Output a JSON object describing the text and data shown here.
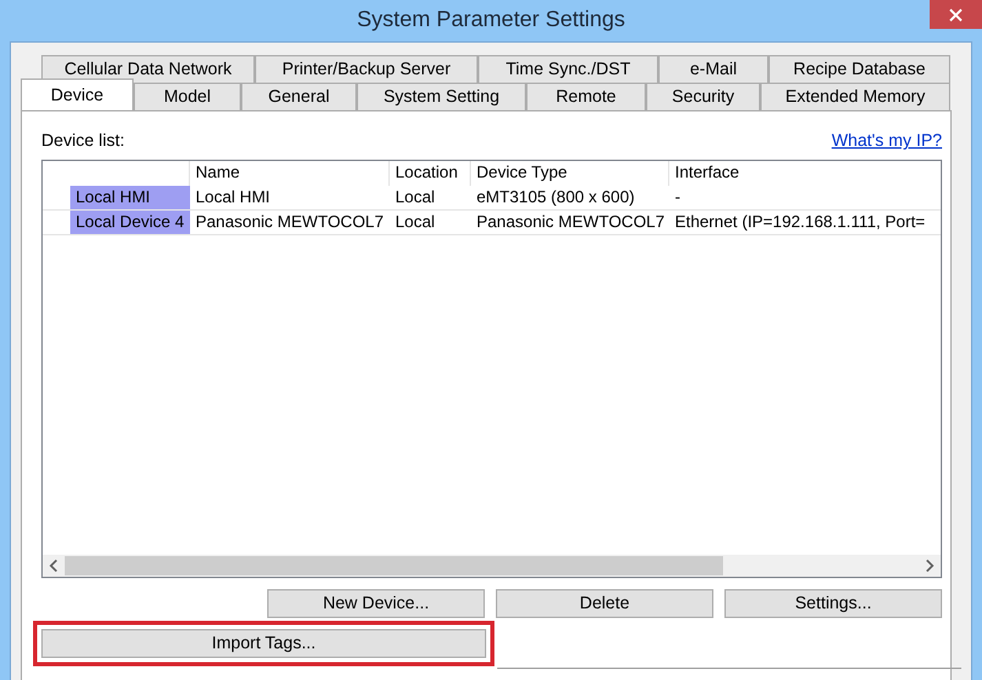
{
  "window": {
    "title": "System Parameter Settings"
  },
  "tab_rows": [
    [
      {
        "label": "Cellular Data Network",
        "selected": false
      },
      {
        "label": "Printer/Backup Server",
        "selected": false
      },
      {
        "label": "Time Sync./DST",
        "selected": false
      },
      {
        "label": "e-Mail",
        "selected": false
      },
      {
        "label": "Recipe Database",
        "selected": false
      }
    ],
    [
      {
        "label": "Device",
        "selected": true
      },
      {
        "label": "Model",
        "selected": false
      },
      {
        "label": "General",
        "selected": false
      },
      {
        "label": "System Setting",
        "selected": false
      },
      {
        "label": "Remote",
        "selected": false
      },
      {
        "label": "Security",
        "selected": false
      },
      {
        "label": "Extended Memory",
        "selected": false
      }
    ]
  ],
  "device_list": {
    "label": "Device list:",
    "link": "What's my IP?",
    "columns": [
      "Name",
      "Location",
      "Device Type",
      "Interface"
    ],
    "rows": [
      {
        "header": "Local HMI",
        "cells": [
          "Local HMI",
          "Local",
          "eMT3105 (800 x 600)",
          "-"
        ]
      },
      {
        "header": "Local Device 4",
        "cells": [
          "Panasonic MEWTOCOL7",
          "Local",
          "Panasonic MEWTOCOL7",
          "Ethernet (IP=192.168.1.111, Port="
        ]
      }
    ]
  },
  "buttons": [
    "New Device...",
    "Delete",
    "Settings..."
  ],
  "import_button": {
    "label": "Import Tags...",
    "highlighted": true
  }
}
